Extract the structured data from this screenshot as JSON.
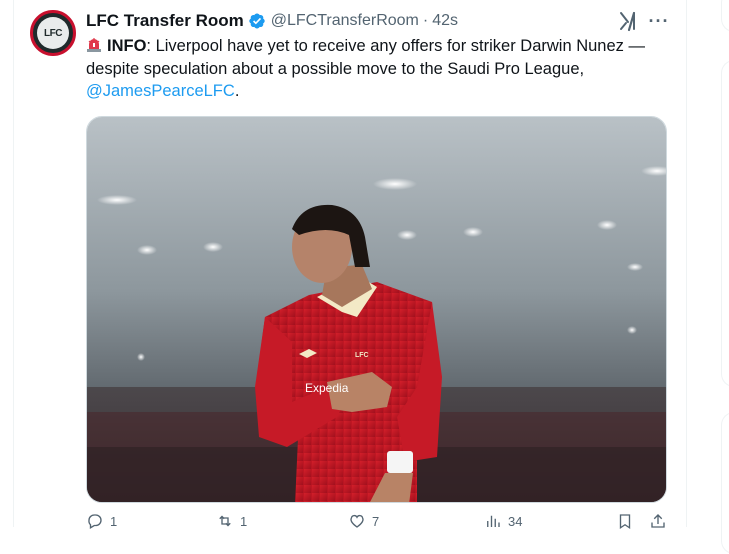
{
  "tweet": {
    "author_name": "LFC Transfer Room",
    "handle": "@LFCTransferRoom",
    "separator": "·",
    "time": "42s",
    "avatar_text": "LFC",
    "text_bold": "INFO",
    "text_body": ": Liverpool have yet to receive any offers for striker Darwin Nunez — despite speculation about a possible move to the Saudi Pro League,",
    "mention": "@JamesPearceLFC",
    "text_end": "."
  },
  "media": {
    "description_icon": "photo-player-in-red-liverpool-kit",
    "sponsor_text": "Expedia",
    "crest_text": "LFC"
  },
  "actions": {
    "replies": "1",
    "reposts": "1",
    "likes": "7",
    "views": "34"
  },
  "icons": {
    "verified": "verified-badge-icon",
    "grok": "grok-icon",
    "more": "more-icon",
    "siren": "siren-icon"
  },
  "colors": {
    "accent": "#1d9bf0",
    "text": "#0f1419",
    "muted": "#536471",
    "kit_red": "#c8102e"
  }
}
